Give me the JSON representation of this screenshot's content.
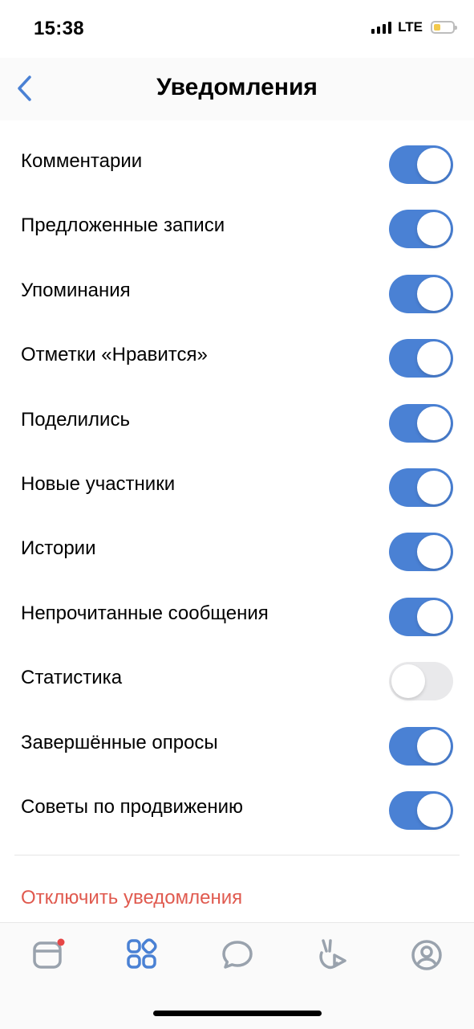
{
  "status_bar": {
    "time": "15:38",
    "network": "LTE"
  },
  "header": {
    "title": "Уведомления",
    "back_icon": "chevron-left-icon"
  },
  "settings": [
    {
      "label": "Комментарии",
      "enabled": true
    },
    {
      "label": "Предложенные записи",
      "enabled": true
    },
    {
      "label": "Упоминания",
      "enabled": true
    },
    {
      "label": "Отметки «Нравится»",
      "enabled": true
    },
    {
      "label": "Поделились",
      "enabled": true
    },
    {
      "label": "Новые участники",
      "enabled": true
    },
    {
      "label": "Истории",
      "enabled": true
    },
    {
      "label": "Непрочитанные сообщения",
      "enabled": true
    },
    {
      "label": "Статистика",
      "enabled": false
    },
    {
      "label": "Завершённые опросы",
      "enabled": true
    },
    {
      "label": "Советы по продвижению",
      "enabled": true
    }
  ],
  "disable_link": "Отключить уведомления",
  "tab_bar": {
    "tabs": [
      "news-icon",
      "services-icon",
      "messages-icon",
      "clips-icon",
      "profile-icon"
    ],
    "active_tab": "services-icon"
  },
  "colors": {
    "accent": "#4a81d4",
    "toggle_off": "#e9e9eb",
    "danger": "#e05a4f",
    "badge": "#e64646",
    "inactive_icon": "#99a2ad"
  }
}
